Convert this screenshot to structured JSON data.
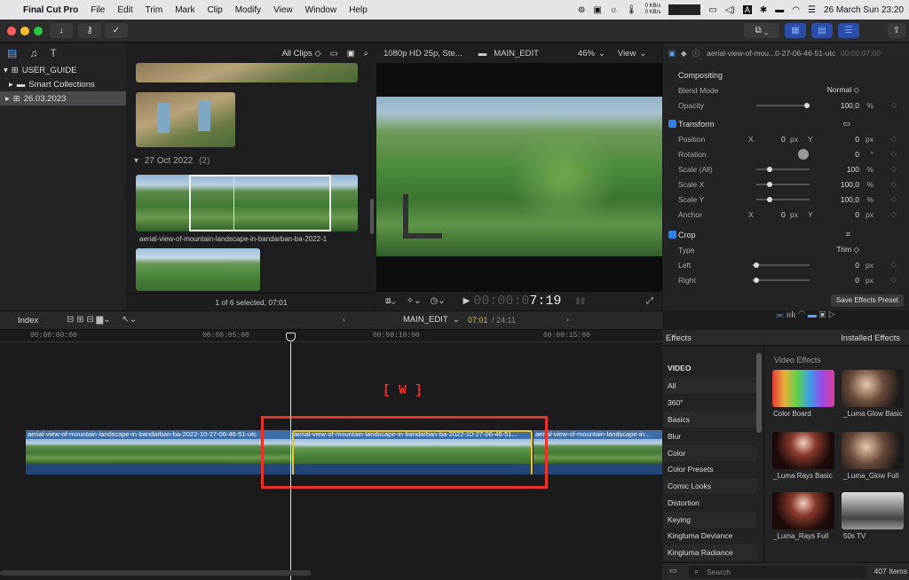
{
  "menubar": {
    "app": "Final Cut Pro",
    "items": [
      "File",
      "Edit",
      "Trim",
      "Mark",
      "Clip",
      "Modify",
      "View",
      "Window",
      "Help"
    ],
    "net_up": "0 KB/s",
    "net_down": "0 KB/s",
    "clock": "26 March Sun  23:20"
  },
  "libraries": {
    "root": "USER_GUIDE",
    "items": [
      "Smart Collections",
      "26.03.2023"
    ]
  },
  "browser": {
    "filter": "All Clips ◇",
    "group_label": "27 Oct 2022",
    "group_count": "(2)",
    "clip_name": "aerial-view-of-mountain-landscape-in-bandarban-ba-2022-1",
    "status": "1 of 6 selected, 07:01"
  },
  "viewer": {
    "format": "1080p HD 25p, Ste...",
    "project": "MAIN_EDIT",
    "zoom": "46%",
    "view_menu": "View",
    "timecode_dim": "00:00:0",
    "timecode_bright": "7:19"
  },
  "inspector": {
    "clip_name": "aerial-view-of-mou...0-27-06-46-51-utc",
    "clip_time": "00:00:07:00",
    "compositing": "Compositing",
    "blend_label": "Blend Mode",
    "blend_value": "Normal ◇",
    "opacity_label": "Opacity",
    "opacity_value": "100,0",
    "pct": "%",
    "transform": "Transform",
    "position_label": "Position",
    "x": "X",
    "y": "Y",
    "pos_x": "0",
    "pos_y": "0",
    "px": "px",
    "rotation_label": "Rotation",
    "rotation_value": "0",
    "deg": "°",
    "scale_all_label": "Scale (All)",
    "scale_all_value": "100",
    "scale_x_label": "Scale X",
    "scale_x_value": "100,0",
    "scale_y_label": "Scale Y",
    "scale_y_value": "100,0",
    "anchor_label": "Anchor",
    "anchor_x": "0",
    "anchor_y": "0",
    "crop": "Crop",
    "type_label": "Type",
    "type_value": "Trim ◇",
    "left_label": "Left",
    "left_value": "0",
    "right_label": "Right",
    "right_value": "0",
    "save_preset": "Save Effects Preset"
  },
  "timeline": {
    "index": "Index",
    "project": "MAIN_EDIT",
    "time_current": "07:01",
    "time_total": "/ 24:11",
    "ticks": [
      "00:00:00:00",
      "00:00:05:00",
      "00:00:10:00",
      "00:00:15:00"
    ],
    "annotation": "[ W ]",
    "clip_name": "aerial-view-of-mountain-landscape-in-bandarban-ba-2022-10-27-06-46-51-utc",
    "clip_name_mid": "aerial-view-of-mountain-landscape-in-bandarban-ba-2022-10-27-06-46-51...",
    "clip_name_right": "aerial-view-of-mountain-landscape-in..."
  },
  "effects": {
    "title": "Effects",
    "installed": "Installed Effects",
    "section": "Video Effects",
    "categories": [
      "VIDEO",
      "All",
      "360°",
      "Basics",
      "Blur",
      "Color",
      "Color Presets",
      "Comic Looks",
      "Distortion",
      "Keying",
      "Kingluma Deviance",
      "Kingluma Radiance"
    ],
    "items": [
      "Color Board",
      "_Luma Glow Basic",
      "_Luma Rays Basic",
      "_Luma_Glow Full",
      "_Luma_Rays Full",
      "50s TV"
    ],
    "search_placeholder": "Search",
    "count": "407 Items"
  }
}
